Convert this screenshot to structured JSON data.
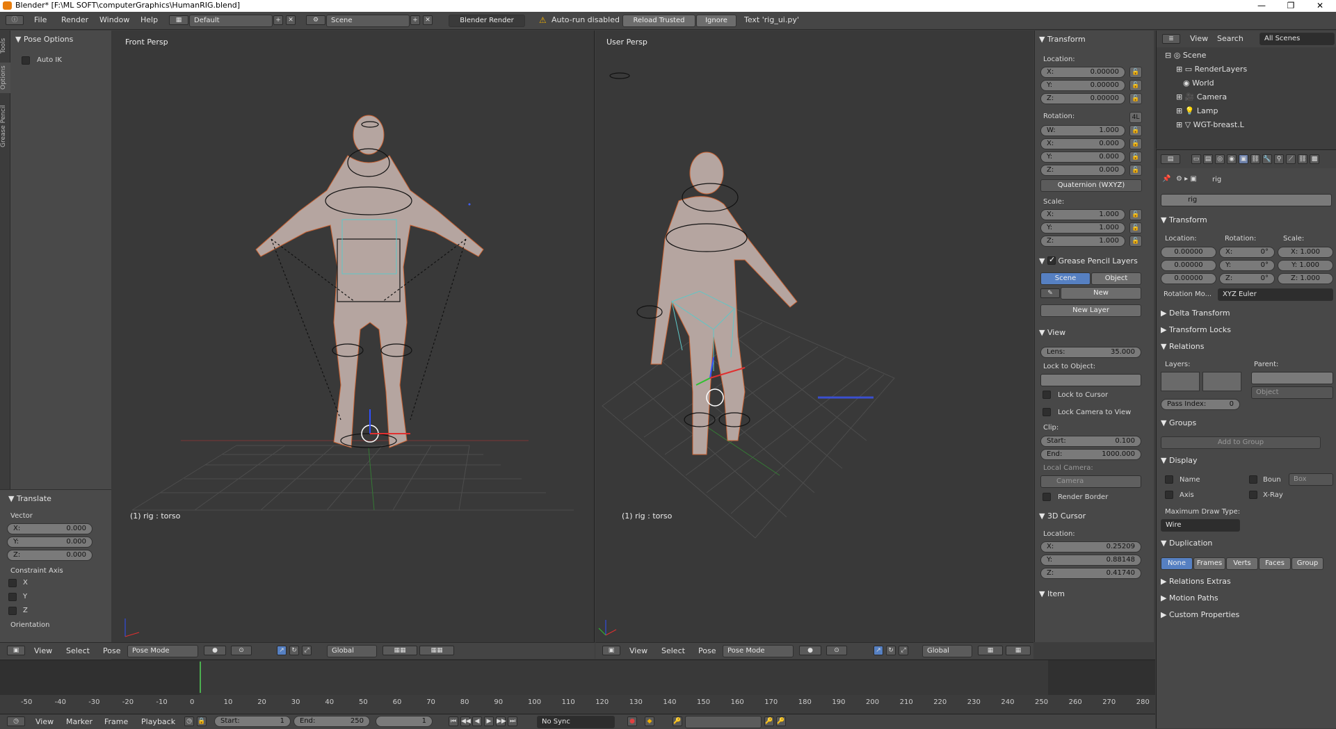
{
  "window": {
    "title": "Blender* [F:\\ML SOFT\\computerGraphics\\HumanRIG.blend]",
    "controls": [
      "—",
      "❐",
      "✕"
    ]
  },
  "info_bar": {
    "menus": [
      "File",
      "Render",
      "Window",
      "Help"
    ],
    "layout": "Default",
    "scene": "Scene",
    "engine": "Blender Render",
    "warning": "Auto-run disabled",
    "reload": "Reload Trusted",
    "ignore": "Ignore",
    "text_info": "Text 'rig_ui.py'"
  },
  "toolshelf": {
    "tabs": [
      "Tools",
      "Options",
      "Grease Pencil"
    ],
    "pose_options": "Pose Options",
    "auto_ik": "Auto IK",
    "translate": "Translate",
    "vector": "Vector",
    "vector_values": [
      {
        "k": "X:",
        "v": "0.000"
      },
      {
        "k": "Y:",
        "v": "0.000"
      },
      {
        "k": "Z:",
        "v": "0.000"
      }
    ],
    "constraint_axis": "Constraint Axis",
    "axes": [
      "X",
      "Y",
      "Z"
    ],
    "orientation": "Orientation"
  },
  "viewport_left": {
    "name": "Front Persp",
    "status": "(1) rig : torso"
  },
  "viewport_right": {
    "name": "User Persp",
    "status": "(1) rig : torso"
  },
  "viewport_header": {
    "menus": [
      "View",
      "Select",
      "Pose"
    ],
    "mode": "Pose Mode",
    "orientation": "Global"
  },
  "npanel": {
    "transform": "Transform",
    "location": "Location:",
    "loc": [
      {
        "k": "X:",
        "v": "0.00000"
      },
      {
        "k": "Y:",
        "v": "0.00000"
      },
      {
        "k": "Z:",
        "v": "0.00000"
      }
    ],
    "rotation": "Rotation:",
    "rot_badge": "4L",
    "rot": [
      {
        "k": "W:",
        "v": "1.000"
      },
      {
        "k": "X:",
        "v": "0.000"
      },
      {
        "k": "Y:",
        "v": "0.000"
      },
      {
        "k": "Z:",
        "v": "0.000"
      }
    ],
    "rot_mode": "Quaternion (WXYZ)",
    "scale": "Scale:",
    "scl": [
      {
        "k": "X:",
        "v": "1.000"
      },
      {
        "k": "Y:",
        "v": "1.000"
      },
      {
        "k": "Z:",
        "v": "1.000"
      }
    ],
    "gp_layers": "Grease Pencil Layers",
    "gp_scene": "Scene",
    "gp_object": "Object",
    "gp_new": "New",
    "gp_new_layer": "New Layer",
    "view": "View",
    "lens_k": "Lens:",
    "lens_v": "35.000",
    "lock_to_object": "Lock to Object:",
    "lock_to_cursor": "Lock to Cursor",
    "lock_camera": "Lock Camera to View",
    "clip": "Clip:",
    "clip_start_k": "Start:",
    "clip_start_v": "0.100",
    "clip_end_k": "End:",
    "clip_end_v": "1000.000",
    "local_camera": "Local Camera:",
    "camera": "Camera",
    "render_border": "Render Border",
    "cursor3d": "3D Cursor",
    "cursor_location": "Location:",
    "cur": [
      {
        "k": "X:",
        "v": "0.25209"
      },
      {
        "k": "Y:",
        "v": "0.88148"
      },
      {
        "k": "Z:",
        "v": "0.41740"
      }
    ],
    "item": "Item"
  },
  "outliner": {
    "menus": [
      "View",
      "Search"
    ],
    "filter": "All Scenes",
    "items": [
      "Scene",
      "RenderLayers",
      "World",
      "Camera",
      "Lamp",
      "WGT-breast.L"
    ]
  },
  "properties": {
    "object": "rig",
    "name_field": "rig",
    "transform": "Transform",
    "location": "Location:",
    "rotation": "Rotation:",
    "scale": "Scale:",
    "loc": [
      "0.00000",
      "0.00000",
      "0.00000"
    ],
    "rot": [
      {
        "k": "X:",
        "v": "0°"
      },
      {
        "k": "Y:",
        "v": "0°"
      },
      {
        "k": "Z:",
        "v": "0°"
      }
    ],
    "scl": [
      "X: 1.000",
      "Y: 1.000",
      "Z: 1.000"
    ],
    "rotation_mode_k": "Rotation Mo...",
    "rotation_mode_v": "XYZ Euler",
    "delta": "Delta Transform",
    "locks": "Transform Locks",
    "relations": "Relations",
    "layers": "Layers:",
    "parent": "Parent:",
    "parent_type": "Object",
    "pass_index_k": "Pass Index:",
    "pass_index_v": "0",
    "groups": "Groups",
    "add_to_group": "Add to Group",
    "display": "Display",
    "name": "Name",
    "axis": "Axis",
    "bounds": "Boun",
    "box": "Box",
    "xray": "X-Ray",
    "max_draw": "Maximum Draw Type:",
    "wire": "Wire",
    "duplication": "Duplication",
    "dup_options": [
      "None",
      "Frames",
      "Verts",
      "Faces",
      "Group"
    ],
    "relations_extras": "Relations Extras",
    "motion_paths": "Motion Paths",
    "custom_props": "Custom Properties"
  },
  "timeline": {
    "ticks": [
      "-50",
      "-40",
      "-30",
      "-20",
      "-10",
      "0",
      "10",
      "20",
      "30",
      "40",
      "50",
      "60",
      "70",
      "80",
      "90",
      "100",
      "110",
      "120",
      "130",
      "140",
      "150",
      "160",
      "170",
      "180",
      "190",
      "200",
      "210",
      "220",
      "230",
      "240",
      "250",
      "260",
      "270",
      "280"
    ],
    "menus": [
      "View",
      "Marker",
      "Frame",
      "Playback"
    ],
    "start_k": "Start:",
    "start_v": "1",
    "end_k": "End:",
    "end_v": "250",
    "current": "1",
    "sync": "No Sync"
  }
}
